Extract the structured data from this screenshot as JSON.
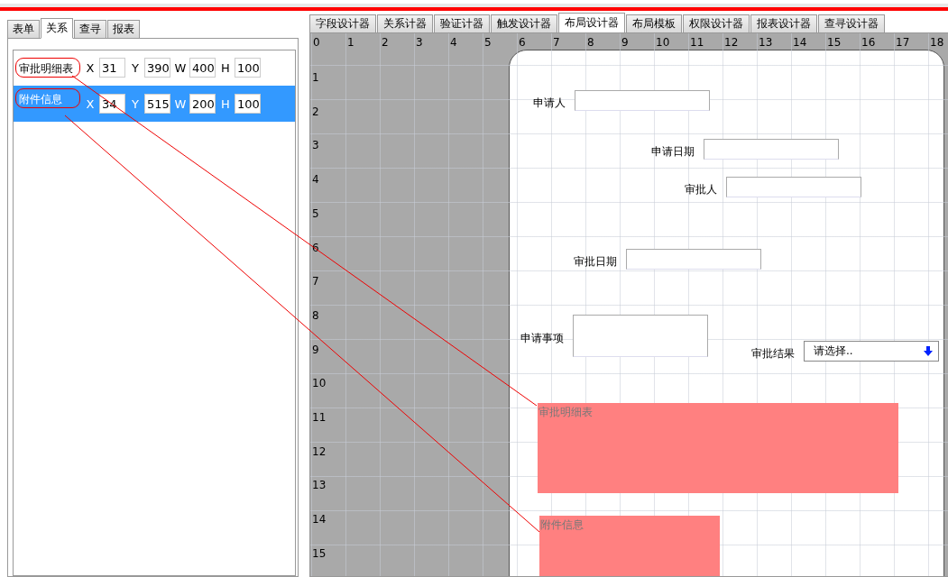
{
  "left_tabs": [
    {
      "label": "表单",
      "selected": false
    },
    {
      "label": "关系",
      "selected": true
    },
    {
      "label": "查寻",
      "selected": false
    },
    {
      "label": "报表",
      "selected": false
    }
  ],
  "relations": [
    {
      "name": "审批明细表",
      "selected": false,
      "fields": [
        {
          "label": "X",
          "value": "31"
        },
        {
          "label": "Y",
          "value": "390"
        },
        {
          "label": "W",
          "value": "400"
        },
        {
          "label": "H",
          "value": "100"
        }
      ]
    },
    {
      "name": "附件信息",
      "selected": true,
      "fields": [
        {
          "label": "X",
          "value": "34"
        },
        {
          "label": "Y",
          "value": "515"
        },
        {
          "label": "W",
          "value": "200"
        },
        {
          "label": "H",
          "value": "100"
        }
      ]
    }
  ],
  "designer_tabs": [
    {
      "label": "字段设计器",
      "selected": false
    },
    {
      "label": "关系计器",
      "selected": false
    },
    {
      "label": "验证计器",
      "selected": false
    },
    {
      "label": "触发设计器",
      "selected": false
    },
    {
      "label": "布局设计器",
      "selected": true
    },
    {
      "label": "布局模板",
      "selected": false
    },
    {
      "label": "权限设计器",
      "selected": false
    },
    {
      "label": "报表设计器",
      "selected": false
    },
    {
      "label": "查寻设计器",
      "selected": false
    }
  ],
  "ruler": {
    "columns": [
      "0",
      "1",
      "2",
      "3",
      "4",
      "5",
      "6",
      "7",
      "8",
      "9",
      "10",
      "11",
      "12",
      "13",
      "14",
      "15",
      "16",
      "17",
      "18"
    ],
    "rows": [
      "1",
      "2",
      "3",
      "4",
      "5",
      "6",
      "7",
      "8",
      "9",
      "10",
      "11",
      "12",
      "13",
      "14",
      "15"
    ]
  },
  "form": {
    "fields": [
      {
        "kind": "input",
        "label": "申请人"
      },
      {
        "kind": "input",
        "label": "申请日期"
      },
      {
        "kind": "input",
        "label": "审批人"
      },
      {
        "kind": "input",
        "label": "审批日期"
      },
      {
        "kind": "textarea",
        "label": "申请事项"
      },
      {
        "kind": "select",
        "label": "审批结果",
        "value": "请选择.."
      }
    ],
    "blocks": [
      {
        "title": "审批明细表"
      },
      {
        "title": "附件信息"
      }
    ]
  }
}
